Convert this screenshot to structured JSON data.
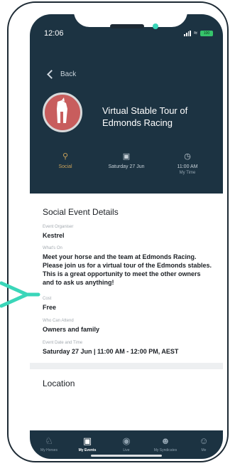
{
  "status_bar": {
    "time": "12:06",
    "battery": "100"
  },
  "header": {
    "back_label": "Back",
    "event_title": "Virtual Stable Tour of Edmonds Racing",
    "meta": [
      {
        "icon": "trophy-icon",
        "label": "Social",
        "sub": ""
      },
      {
        "icon": "calendar-icon",
        "label": "Saturday 27 Jun",
        "sub": ""
      },
      {
        "icon": "clock-icon",
        "label": "11:00 AM",
        "sub": "My Time"
      }
    ]
  },
  "details": {
    "section_title": "Social Event Details",
    "fields": [
      {
        "label": "Event Organiser",
        "value": "Kestrel",
        "bold": true
      },
      {
        "label": "What's On",
        "value": "Meet your horse and the team at Edmonds Racing. Please join us for a virtual tour of the Edmonds stables. This is a great opportunity to meet the other owners and to ask us anything!",
        "bold": true
      },
      {
        "label": "Cost",
        "value": "Free",
        "bold": true
      },
      {
        "label": "Who Can Attend",
        "value": "Owners and family",
        "bold": true
      },
      {
        "label": "Event Date and Time",
        "value": "Saturday 27 Jun | 11:00 AM - 12:00 PM, AEST",
        "bold": true
      }
    ]
  },
  "location": {
    "section_title": "Location"
  },
  "tabbar": {
    "tabs": [
      {
        "label": "My Horses",
        "icon": "horse-icon",
        "active": false
      },
      {
        "label": "My Events",
        "icon": "calendar-icon",
        "active": true
      },
      {
        "label": "Live",
        "icon": "live-icon",
        "active": false
      },
      {
        "label": "My Syndicates",
        "icon": "group-icon",
        "active": false
      },
      {
        "label": "Me",
        "icon": "person-icon",
        "active": false
      }
    ]
  },
  "colors": {
    "header_bg": "#1c3342",
    "accent_gold": "#c8a15a",
    "annotation": "#3ad6b9"
  }
}
